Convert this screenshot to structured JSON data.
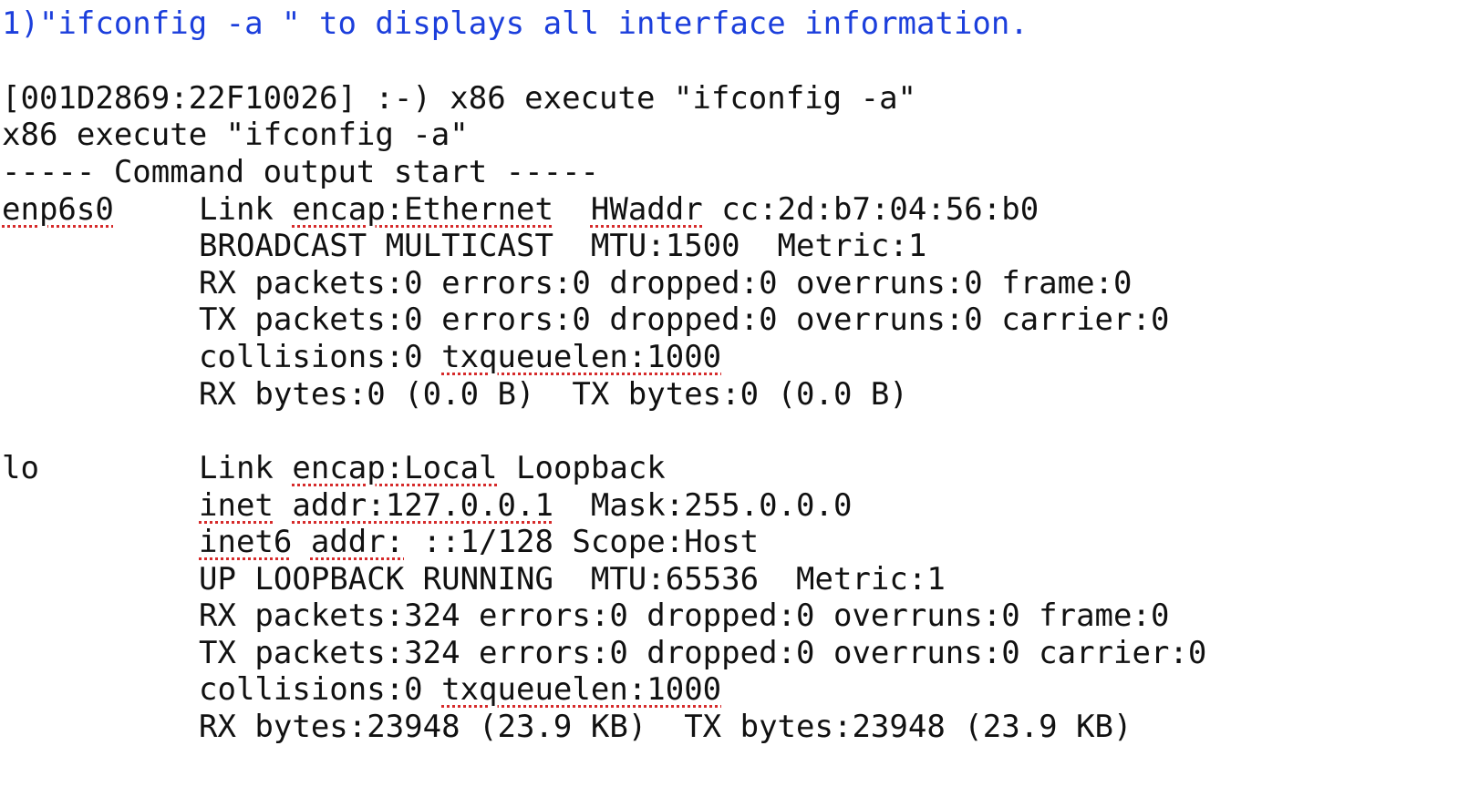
{
  "heading": "1)\"ifconfig -a \" to displays all interface information.",
  "prompt_line": "[001D2869:22F10026] :-) x86 execute \"ifconfig -a\"",
  "echo_line": "x86 execute \"ifconfig -a\"",
  "output_start": "----- Command output start -----",
  "interfaces": [
    {
      "name": "enp6s0",
      "rows": [
        [
          "Link ",
          "encap:Ethernet",
          "  ",
          "HWaddr",
          " cc:2d:b7:04:56:b0"
        ],
        [
          "BROADCAST MULTICAST  MTU:1500  Metric:1"
        ],
        [
          "RX packets:0 errors:0 dropped:0 overruns:0 frame:0"
        ],
        [
          "TX packets:0 errors:0 dropped:0 overruns:0 carrier:0"
        ],
        [
          "collisions:0 ",
          "txqueuelen:1000"
        ],
        [
          "RX bytes:0 (0.0 B)  TX bytes:0 (0.0 B)"
        ]
      ]
    },
    {
      "name": "lo",
      "rows": [
        [
          "Link ",
          "encap:Local",
          " Loopback"
        ],
        [
          "inet",
          " ",
          "addr:127.0.0.1",
          "  Mask:255.0.0.0"
        ],
        [
          "inet6",
          " ",
          "addr:",
          " ::1/128 Scope:Host"
        ],
        [
          "UP LOOPBACK RUNNING  MTU:65536  Metric:1"
        ],
        [
          "RX packets:324 errors:0 dropped:0 overruns:0 frame:0"
        ],
        [
          "TX packets:324 errors:0 dropped:0 overruns:0 carrier:0"
        ],
        [
          "collisions:0 ",
          "txqueuelen:1000"
        ],
        [
          "RX bytes:23948 (23.9 KB)  TX bytes:23948 (23.9 KB)"
        ]
      ]
    }
  ]
}
